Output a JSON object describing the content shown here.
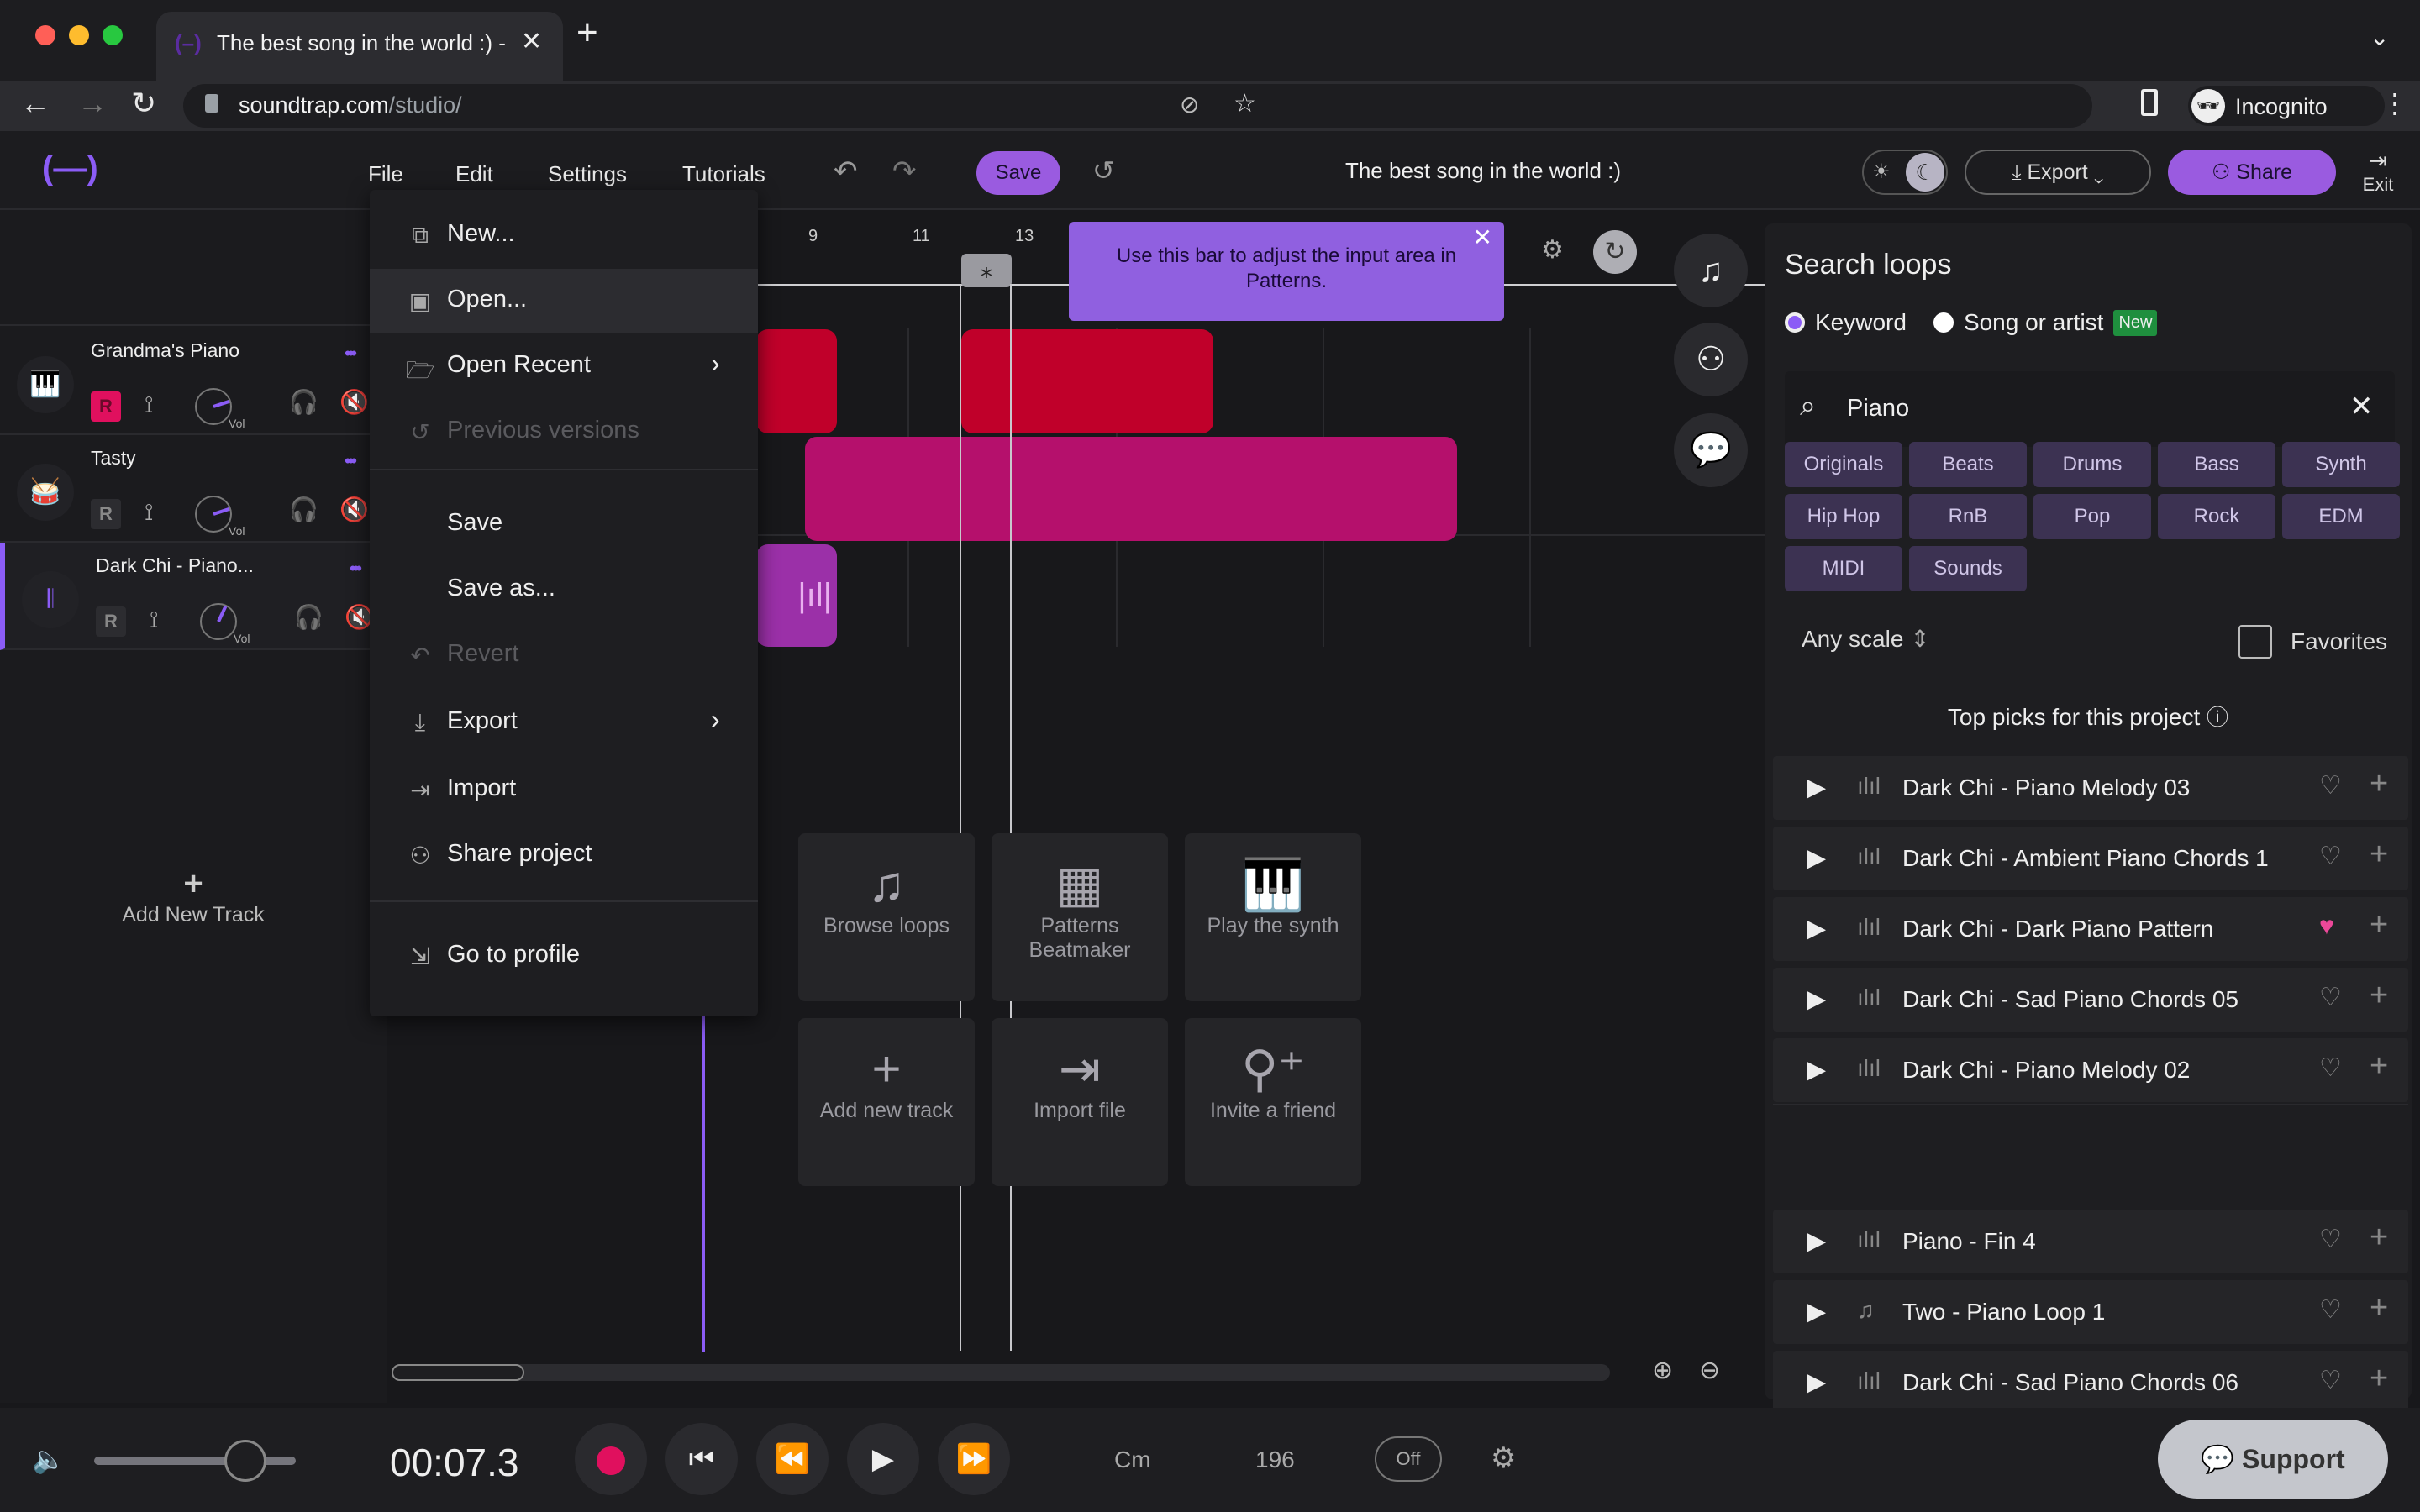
{
  "browser": {
    "tab_title": "The best song in the world :) -",
    "url_domain": "soundtrap.com",
    "url_path": "/studio/",
    "profile_label": "Incognito"
  },
  "header": {
    "menus": [
      "File",
      "Edit",
      "Settings",
      "Tutorials"
    ],
    "save_label": "Save",
    "song_title": "The best song in the world :)",
    "export_label": "Export",
    "share_label": "Share",
    "exit_label": "Exit"
  },
  "file_menu": {
    "items": [
      {
        "label": "New...",
        "icon": "new-file-icon",
        "disabled": false,
        "submenu": false
      },
      {
        "label": "Open...",
        "icon": "open-icon",
        "disabled": false,
        "submenu": false,
        "hover": true
      },
      {
        "label": "Open Recent",
        "icon": "folder-icon",
        "disabled": false,
        "submenu": true
      },
      {
        "label": "Previous versions",
        "icon": "history-icon",
        "disabled": true,
        "submenu": false
      },
      {
        "label": "Save",
        "disabled": false
      },
      {
        "label": "Save as...",
        "disabled": false
      },
      {
        "label": "Revert",
        "icon": "revert-icon",
        "disabled": true
      },
      {
        "label": "Export",
        "icon": "download-icon",
        "disabled": false,
        "submenu": true
      },
      {
        "label": "Import",
        "icon": "import-icon",
        "disabled": false
      },
      {
        "label": "Share project",
        "icon": "share-icon",
        "disabled": false
      },
      {
        "label": "Go to profile",
        "icon": "profile-exit-icon",
        "disabled": false
      }
    ]
  },
  "tracks": [
    {
      "name": "Grandma's Piano",
      "icon": "piano-icon",
      "record_armed": true,
      "volume_label": "Vol"
    },
    {
      "name": "Tasty",
      "icon": "drum-icon",
      "record_armed": false,
      "volume_label": "Vol"
    },
    {
      "name": "Dark Chi - Piano...",
      "icon": "waveform-icon",
      "record_armed": false,
      "volume_label": "Vol",
      "selected": true
    }
  ],
  "add_track_label": "Add New Track",
  "ruler": {
    "ticks": [
      "9",
      "11",
      "13"
    ]
  },
  "tooltip": {
    "text": "Use this bar to adjust the input area in Patterns."
  },
  "quick_actions": [
    {
      "label": "Browse loops",
      "icon": "music-note-icon"
    },
    {
      "label": "Patterns Beatmaker",
      "icon": "grid-icon"
    },
    {
      "label": "Play the synth",
      "icon": "piano-icon"
    },
    {
      "label": "Add new track",
      "icon": "plus-icon"
    },
    {
      "label": "Import file",
      "icon": "import-icon"
    },
    {
      "label": "Invite a friend",
      "icon": "add-user-icon"
    }
  ],
  "loops": {
    "title": "Search loops",
    "mode_keyword": "Keyword",
    "mode_song": "Song or artist",
    "new_badge": "New",
    "search_value": "Piano",
    "chips": [
      "Originals",
      "Beats",
      "Drums",
      "Bass",
      "Synth",
      "Hip Hop",
      "RnB",
      "Pop",
      "Rock",
      "EDM",
      "MIDI",
      "Sounds"
    ],
    "scale_label": "Any scale",
    "favorites_label": "Favorites",
    "top_picks_title": "Top picks for this project",
    "top_picks": [
      {
        "name": "Dark Chi - Piano Melody 03",
        "favorite": false
      },
      {
        "name": "Dark Chi - Ambient Piano Chords 1",
        "favorite": false
      },
      {
        "name": "Dark Chi - Dark Piano Pattern",
        "favorite": true
      },
      {
        "name": "Dark Chi - Sad Piano Chords 05",
        "favorite": false
      },
      {
        "name": "Dark Chi - Piano Melody 02",
        "favorite": false
      }
    ],
    "results": [
      {
        "name": "Piano - Fin 4",
        "type": "audio",
        "favorite": false
      },
      {
        "name": "Two - Piano Loop 1",
        "type": "midi",
        "favorite": false
      },
      {
        "name": "Dark Chi - Sad Piano Chords 06",
        "type": "audio",
        "favorite": false
      }
    ]
  },
  "transport": {
    "time": "00:07.3",
    "key": "Cm",
    "tempo": "196",
    "metronome": "Off",
    "master_volume_fraction": 0.75
  },
  "support_label": "Support",
  "colors": {
    "accent": "#9a5be0",
    "record": "#e0105e",
    "clip_red": "#c0002a",
    "clip_magenta": "#b5106c",
    "clip_purple": "#9b30a8"
  }
}
